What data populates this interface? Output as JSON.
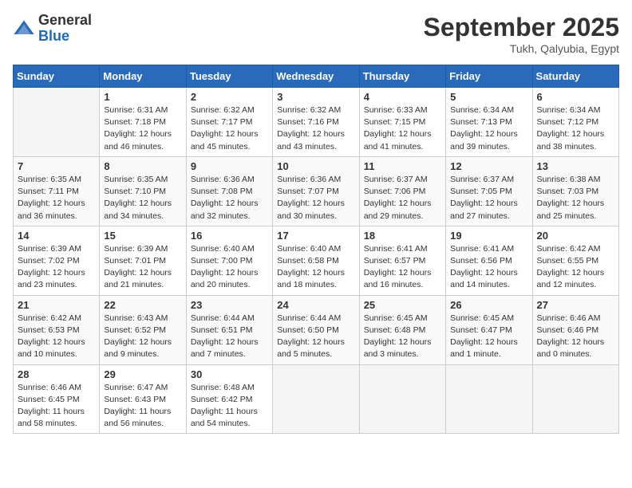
{
  "header": {
    "logo_general": "General",
    "logo_blue": "Blue",
    "month": "September 2025",
    "location": "Tukh, Qalyubia, Egypt"
  },
  "days_of_week": [
    "Sunday",
    "Monday",
    "Tuesday",
    "Wednesday",
    "Thursday",
    "Friday",
    "Saturday"
  ],
  "weeks": [
    [
      {
        "day": "",
        "info": ""
      },
      {
        "day": "1",
        "info": "Sunrise: 6:31 AM\nSunset: 7:18 PM\nDaylight: 12 hours and 46 minutes."
      },
      {
        "day": "2",
        "info": "Sunrise: 6:32 AM\nSunset: 7:17 PM\nDaylight: 12 hours and 45 minutes."
      },
      {
        "day": "3",
        "info": "Sunrise: 6:32 AM\nSunset: 7:16 PM\nDaylight: 12 hours and 43 minutes."
      },
      {
        "day": "4",
        "info": "Sunrise: 6:33 AM\nSunset: 7:15 PM\nDaylight: 12 hours and 41 minutes."
      },
      {
        "day": "5",
        "info": "Sunrise: 6:34 AM\nSunset: 7:13 PM\nDaylight: 12 hours and 39 minutes."
      },
      {
        "day": "6",
        "info": "Sunrise: 6:34 AM\nSunset: 7:12 PM\nDaylight: 12 hours and 38 minutes."
      }
    ],
    [
      {
        "day": "7",
        "info": "Sunrise: 6:35 AM\nSunset: 7:11 PM\nDaylight: 12 hours and 36 minutes."
      },
      {
        "day": "8",
        "info": "Sunrise: 6:35 AM\nSunset: 7:10 PM\nDaylight: 12 hours and 34 minutes."
      },
      {
        "day": "9",
        "info": "Sunrise: 6:36 AM\nSunset: 7:08 PM\nDaylight: 12 hours and 32 minutes."
      },
      {
        "day": "10",
        "info": "Sunrise: 6:36 AM\nSunset: 7:07 PM\nDaylight: 12 hours and 30 minutes."
      },
      {
        "day": "11",
        "info": "Sunrise: 6:37 AM\nSunset: 7:06 PM\nDaylight: 12 hours and 29 minutes."
      },
      {
        "day": "12",
        "info": "Sunrise: 6:37 AM\nSunset: 7:05 PM\nDaylight: 12 hours and 27 minutes."
      },
      {
        "day": "13",
        "info": "Sunrise: 6:38 AM\nSunset: 7:03 PM\nDaylight: 12 hours and 25 minutes."
      }
    ],
    [
      {
        "day": "14",
        "info": "Sunrise: 6:39 AM\nSunset: 7:02 PM\nDaylight: 12 hours and 23 minutes."
      },
      {
        "day": "15",
        "info": "Sunrise: 6:39 AM\nSunset: 7:01 PM\nDaylight: 12 hours and 21 minutes."
      },
      {
        "day": "16",
        "info": "Sunrise: 6:40 AM\nSunset: 7:00 PM\nDaylight: 12 hours and 20 minutes."
      },
      {
        "day": "17",
        "info": "Sunrise: 6:40 AM\nSunset: 6:58 PM\nDaylight: 12 hours and 18 minutes."
      },
      {
        "day": "18",
        "info": "Sunrise: 6:41 AM\nSunset: 6:57 PM\nDaylight: 12 hours and 16 minutes."
      },
      {
        "day": "19",
        "info": "Sunrise: 6:41 AM\nSunset: 6:56 PM\nDaylight: 12 hours and 14 minutes."
      },
      {
        "day": "20",
        "info": "Sunrise: 6:42 AM\nSunset: 6:55 PM\nDaylight: 12 hours and 12 minutes."
      }
    ],
    [
      {
        "day": "21",
        "info": "Sunrise: 6:42 AM\nSunset: 6:53 PM\nDaylight: 12 hours and 10 minutes."
      },
      {
        "day": "22",
        "info": "Sunrise: 6:43 AM\nSunset: 6:52 PM\nDaylight: 12 hours and 9 minutes."
      },
      {
        "day": "23",
        "info": "Sunrise: 6:44 AM\nSunset: 6:51 PM\nDaylight: 12 hours and 7 minutes."
      },
      {
        "day": "24",
        "info": "Sunrise: 6:44 AM\nSunset: 6:50 PM\nDaylight: 12 hours and 5 minutes."
      },
      {
        "day": "25",
        "info": "Sunrise: 6:45 AM\nSunset: 6:48 PM\nDaylight: 12 hours and 3 minutes."
      },
      {
        "day": "26",
        "info": "Sunrise: 6:45 AM\nSunset: 6:47 PM\nDaylight: 12 hours and 1 minute."
      },
      {
        "day": "27",
        "info": "Sunrise: 6:46 AM\nSunset: 6:46 PM\nDaylight: 12 hours and 0 minutes."
      }
    ],
    [
      {
        "day": "28",
        "info": "Sunrise: 6:46 AM\nSunset: 6:45 PM\nDaylight: 11 hours and 58 minutes."
      },
      {
        "day": "29",
        "info": "Sunrise: 6:47 AM\nSunset: 6:43 PM\nDaylight: 11 hours and 56 minutes."
      },
      {
        "day": "30",
        "info": "Sunrise: 6:48 AM\nSunset: 6:42 PM\nDaylight: 11 hours and 54 minutes."
      },
      {
        "day": "",
        "info": ""
      },
      {
        "day": "",
        "info": ""
      },
      {
        "day": "",
        "info": ""
      },
      {
        "day": "",
        "info": ""
      }
    ]
  ]
}
